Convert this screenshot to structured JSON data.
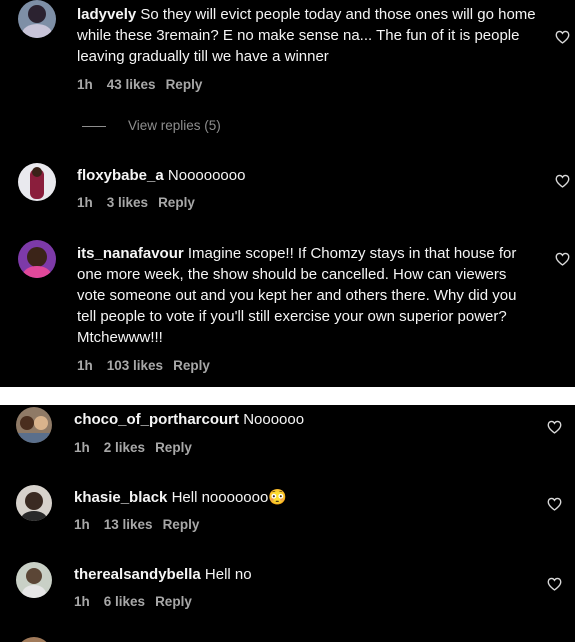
{
  "comments_top": [
    {
      "username": "ladyvely",
      "text": "So they will evict people today and those ones will go home while these 3remain? E no make sense na... The fun of it is people leaving gradually till we have a winner",
      "time": "1h",
      "likes": "43 likes",
      "reply": "Reply",
      "view_replies": "View replies (5)"
    },
    {
      "username": "floxybabe_a",
      "text": "Noooooooo",
      "time": "1h",
      "likes": "3 likes",
      "reply": "Reply"
    },
    {
      "username": "its_nanafavour",
      "text": "Imagine scope!! If Chomzy stays in that house for one more week, the show should be cancelled. How can viewers vote someone out and you kept her and others there. Why did you tell people to vote if you'll still exercise your own superior power? Mtchewww!!!",
      "time": "1h",
      "likes": "103 likes",
      "reply": "Reply"
    }
  ],
  "comments_bottom": [
    {
      "username": "choco_of_portharcourt",
      "text": "Noooooo",
      "time": "1h",
      "likes": "2 likes",
      "reply": "Reply"
    },
    {
      "username": "khasie_black",
      "text": "Hell nooooooo",
      "emoji": "😳",
      "time": "1h",
      "likes": "13 likes",
      "reply": "Reply"
    },
    {
      "username": "therealsandybella",
      "text": "Hell no",
      "time": "1h",
      "likes": "6 likes",
      "reply": "Reply"
    }
  ],
  "icons": {
    "like": "heart-outline-icon",
    "avatar": "profile-photo"
  },
  "colors": {
    "background": "#000000",
    "text": "#f5f5f5",
    "meta": "#a8a8a8",
    "separator": "#ffffff"
  }
}
